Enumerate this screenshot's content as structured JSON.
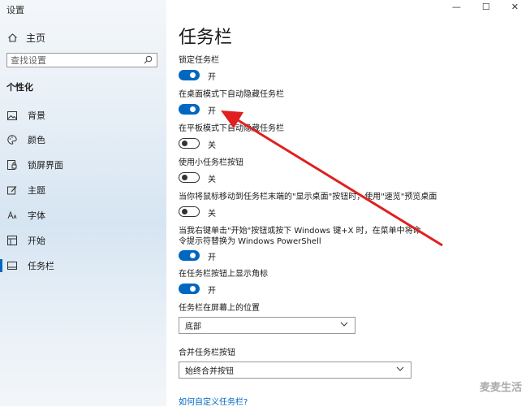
{
  "app": {
    "title": "设置"
  },
  "window_controls": {
    "minimize": "—",
    "maximize": "☐",
    "close": "✕"
  },
  "sidebar": {
    "home": "主页",
    "search_placeholder": "查找设置",
    "section": "个性化",
    "items": [
      {
        "label": "背景",
        "icon": "picture-icon"
      },
      {
        "label": "颜色",
        "icon": "palette-icon"
      },
      {
        "label": "锁屏界面",
        "icon": "lockscreen-icon"
      },
      {
        "label": "主题",
        "icon": "theme-brush-icon"
      },
      {
        "label": "字体",
        "icon": "font-icon"
      },
      {
        "label": "开始",
        "icon": "start-icon"
      },
      {
        "label": "任务栏",
        "icon": "taskbar-icon",
        "active": true
      }
    ]
  },
  "main": {
    "title": "任务栏",
    "settings": [
      {
        "label": "锁定任务栏",
        "state": "开",
        "on": true
      },
      {
        "label": "在桌面模式下自动隐藏任务栏",
        "state": "开",
        "on": true
      },
      {
        "label": "在平板模式下自动隐藏任务栏",
        "state": "关",
        "on": false
      },
      {
        "label": "使用小任务栏按钮",
        "state": "关",
        "on": false
      },
      {
        "label": "当你将鼠标移动到任务栏末端的\"显示桌面\"按钮时，使用\"速览\"预览桌面",
        "state": "关",
        "on": false
      },
      {
        "label": "当我右键单击\"开始\"按钮或按下 Windows 键+X 时，在菜单中将命令提示符替换为 Windows PowerShell",
        "state": "开",
        "on": true
      },
      {
        "label": "在任务栏按钮上显示角标",
        "state": "开",
        "on": true
      }
    ],
    "position_label": "任务栏在屏幕上的位置",
    "position_value": "底部",
    "combine_label": "合并任务栏按钮",
    "combine_value": "始终合并按钮",
    "customize_link": "如何自定义任务栏?"
  },
  "watermark": "麦麦生活",
  "accent_color": "#0067c0",
  "annotation_color": "#e02020"
}
